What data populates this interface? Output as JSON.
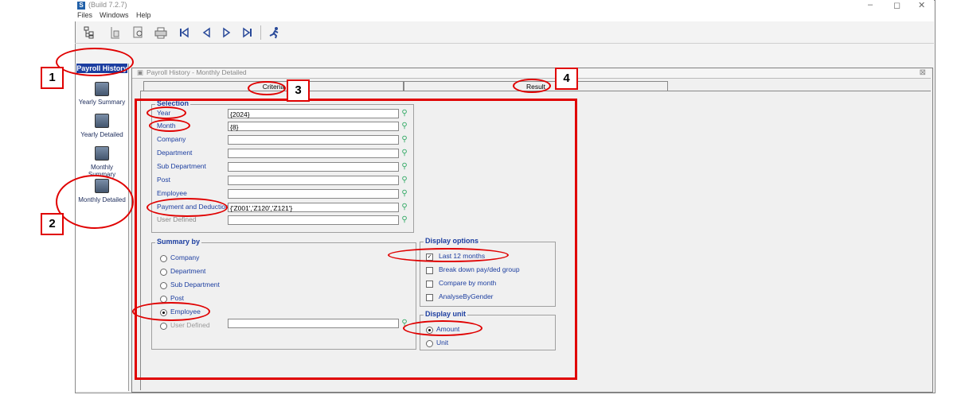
{
  "window": {
    "title": "(Build 7.2.7)",
    "app_icon_letter": "S",
    "controls": [
      "–",
      "◻",
      "✕"
    ]
  },
  "menu": [
    "Files",
    "Windows",
    "Help"
  ],
  "toolbar": {
    "icons": [
      "tree-icon",
      "doc-icon",
      "preview-icon",
      "print-icon",
      "first-icon",
      "prev-icon",
      "next-icon",
      "last-icon",
      "run-icon"
    ]
  },
  "sidebar": {
    "header": "Payroll History",
    "items": [
      {
        "label": "Yearly Summary"
      },
      {
        "label": "Yearly Detailed"
      },
      {
        "label": "Monthly Summary"
      },
      {
        "label": "Monthly Detailed"
      }
    ]
  },
  "panel": {
    "title": "Payroll History - Monthly Detailed",
    "close_glyph": "⊠"
  },
  "tabs": {
    "criteria": "Criteria",
    "result": "Result"
  },
  "selection": {
    "title": "Selection",
    "rows": [
      {
        "label": "Year",
        "value": "{2024}"
      },
      {
        "label": "Month",
        "value": "{8}"
      },
      {
        "label": "Company",
        "value": ""
      },
      {
        "label": "Department",
        "value": ""
      },
      {
        "label": "Sub Department",
        "value": ""
      },
      {
        "label": "Post",
        "value": ""
      },
      {
        "label": "Employee",
        "value": ""
      },
      {
        "label": "Payment and Deduction",
        "value": "{'Z001','Z120','Z121'}"
      },
      {
        "label": "User Defined",
        "value": ""
      }
    ]
  },
  "summary_by": {
    "title": "Summary by",
    "options": [
      {
        "label": "Company",
        "selected": false
      },
      {
        "label": "Department",
        "selected": false
      },
      {
        "label": "Sub Department",
        "selected": false
      },
      {
        "label": "Post",
        "selected": false
      },
      {
        "label": "Employee",
        "selected": true
      },
      {
        "label": "User Defined",
        "selected": false
      }
    ]
  },
  "display_options": {
    "title": "Display options",
    "items": [
      {
        "label": "Last 12 months",
        "checked": true
      },
      {
        "label": "Break down pay/ded group",
        "checked": false
      },
      {
        "label": "Compare by month",
        "checked": false
      },
      {
        "label": "AnalyseByGender",
        "checked": false
      }
    ]
  },
  "display_unit": {
    "title": "Display unit",
    "options": [
      {
        "label": "Amount",
        "selected": true
      },
      {
        "label": "Unit",
        "selected": false
      }
    ]
  },
  "callouts": [
    "1",
    "2",
    "3",
    "4"
  ],
  "colors": {
    "annotation": "#e00000",
    "label_blue": "#1c3ea0",
    "sidebar_header": "#1c3ea0"
  }
}
